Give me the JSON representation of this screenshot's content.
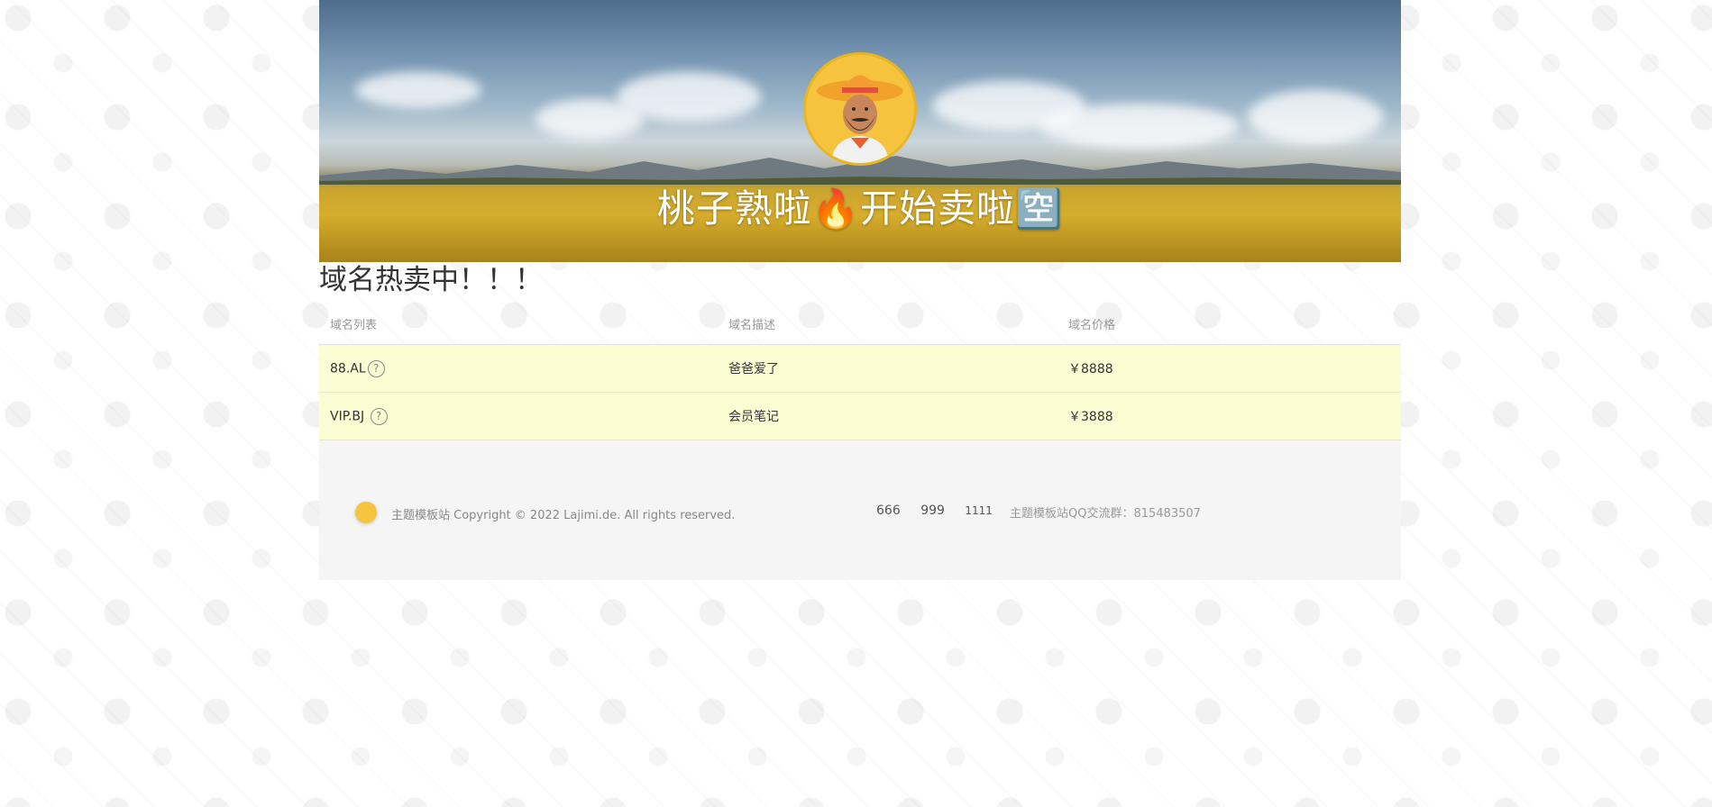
{
  "hero": {
    "title": "桃子熟啦🔥开始卖啦🈳"
  },
  "section": {
    "title": "域名热卖中！！！"
  },
  "table": {
    "headers": [
      "域名列表",
      "域名描述",
      "域名价格"
    ],
    "rows": [
      {
        "domain": "88.AL",
        "description": "爸爸爱了",
        "price": "￥8888"
      },
      {
        "domain": "VIP.BJ",
        "description": "会员笔记",
        "price": "￥3888"
      }
    ],
    "help_glyph": "?"
  },
  "footer": {
    "copyright": "主题模板站 Copyright © 2022 Lajimi.de. All rights reserved.",
    "links": [
      "666",
      "999",
      "1111"
    ],
    "group": "主题模板站QQ交流群：815483507"
  },
  "colors": {
    "row_highlight": "#fdfdd4",
    "footer_bg": "#f5f5f5",
    "avatar_gold": "#e8b525"
  }
}
